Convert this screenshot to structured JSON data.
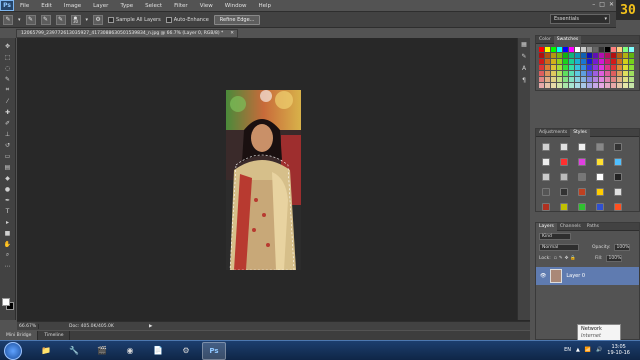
{
  "app": {
    "logo_text": "Ps",
    "counter_text": "30"
  },
  "menu": [
    "File",
    "Edit",
    "Image",
    "Layer",
    "Type",
    "Select",
    "Filter",
    "View",
    "Window",
    "Help"
  ],
  "options_bar": {
    "brush_size": "30",
    "sample_all_layers": "Sample All Layers",
    "auto_enhance": "Auto-Enhance",
    "refine_edge": "Refine Edge...",
    "workspace": "Essentials"
  },
  "document": {
    "tab_title": "12065799_239772613035927_4173088630501539834_n.jpg @ 66.7% (Layer 0, RGB/8) *",
    "zoom": "66.67%",
    "doc_info": "Doc: 405.0K/405.0K"
  },
  "bottom_tabs": [
    "Mini Bridge",
    "Timeline"
  ],
  "panels": {
    "color_tabs": [
      "Color",
      "Swatches"
    ],
    "adjust_tabs": [
      "Adjustments",
      "Styles"
    ],
    "layers_tabs": [
      "Layers",
      "Channels",
      "Paths"
    ],
    "kind_label": "Kind",
    "blend_mode": "Normal",
    "opacity_label": "Opacity:",
    "opacity_value": "100%",
    "lock_label": "Lock:",
    "fill_label": "Fill:",
    "fill_value": "100%",
    "layer_name": "Layer 0"
  },
  "tooltip": {
    "title": "Network",
    "subtitle": "Internet access"
  },
  "taskbar": {
    "language": "EN",
    "time": "13:05",
    "date": "19-10-16"
  },
  "colors": {
    "swatches": [
      "#ff0000",
      "#ffff00",
      "#00ff00",
      "#00ffff",
      "#0000ff",
      "#ff00ff",
      "#ffffff",
      "#cccccc",
      "#999999",
      "#666666",
      "#333333",
      "#000000",
      "#ff8080",
      "#ffd080",
      "#80ff80",
      "#80ffff"
    ]
  }
}
